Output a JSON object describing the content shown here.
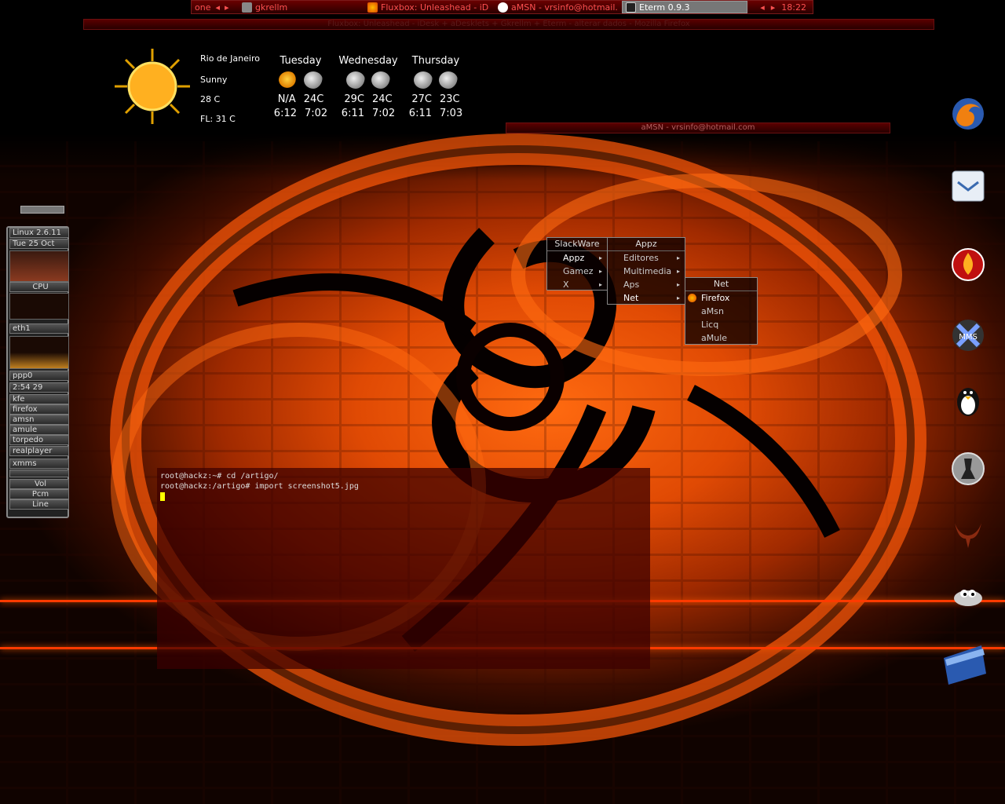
{
  "taskbar": {
    "workspace": "one",
    "tasks": [
      {
        "label": "gkrellm",
        "icon": "gkrellm-icon"
      },
      {
        "label": "Fluxbox: Unleashead - iD",
        "icon": "firefox-icon"
      },
      {
        "label": "aMSN - vrsinfo@hotmail.",
        "icon": "amsn-icon"
      },
      {
        "label": "Eterm 0.9.3",
        "icon": "terminal-icon"
      }
    ],
    "clock": "18:22",
    "colors": {
      "accent": "#ff5050",
      "bar": "#4a0000"
    }
  },
  "firefox_window": {
    "title": "Fluxbox: Unleashead - iDesk + aDesklets + Gkrellm + Eterm - alterar dados - Mozilla Firefox"
  },
  "amsn_window": {
    "title": "aMSN - vrsinfo@hotmail.com"
  },
  "weather": {
    "city": "Rio de Janeiro",
    "condition": "Sunny",
    "temp": "28 C",
    "feels_like": "FL: 31 C",
    "days": [
      {
        "name": "Tuesday",
        "icons": [
          "partly-sunny-icon",
          "storm-icon"
        ],
        "temps": [
          "N/A",
          "24C"
        ],
        "times": [
          "6:12",
          "7:02"
        ]
      },
      {
        "name": "Wednesday",
        "icons": [
          "storm-icon",
          "storm-icon"
        ],
        "temps": [
          "29C",
          "24C"
        ],
        "times": [
          "6:11",
          "7:02"
        ]
      },
      {
        "name": "Thursday",
        "icons": [
          "storm-icon",
          "storm-icon"
        ],
        "temps": [
          "27C",
          "23C"
        ],
        "times": [
          "6:11",
          "7:03"
        ]
      }
    ]
  },
  "gkrellm": {
    "kernel": "Linux 2.6.11",
    "date": "Tue 25 Oct",
    "cpu_label": "CPU",
    "eth": "eth1",
    "ppp": "ppp0",
    "uptime": "2:54  29",
    "procs": [
      "kfe",
      "firefox",
      "amsn",
      "amule",
      "torpedo",
      "realplayer"
    ],
    "xmms": "xmms",
    "mixer": [
      "Vol",
      "Pcm",
      "Line"
    ]
  },
  "dock": [
    "firefox-icon",
    "mail-icon",
    "burner-icon",
    "xmms-icon",
    "tux-icon",
    "counter-strike-icon",
    "quake-icon",
    "gimp-icon",
    "folder-icon"
  ],
  "menus": {
    "root": {
      "title": "SlackWare",
      "items": [
        "Appz",
        "Gamez",
        "X"
      ]
    },
    "appz": {
      "title": "Appz",
      "items": [
        "Editores",
        "Multimedia",
        "Aps",
        "Net"
      ]
    },
    "net": {
      "title": "Net",
      "items": [
        "Firefox",
        "aMsn",
        "Licq",
        "aMule"
      ]
    }
  },
  "terminal": {
    "lines": [
      "root@hackz:~# cd /artigo/",
      "root@hackz:/artigo# import screenshot5.jpg"
    ]
  }
}
